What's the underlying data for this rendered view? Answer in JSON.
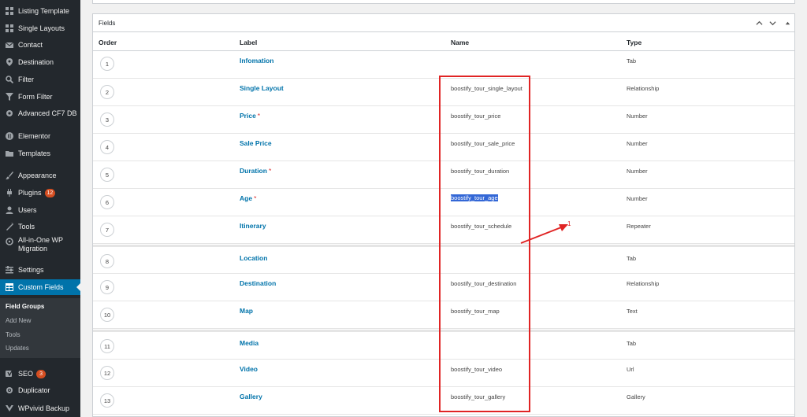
{
  "sidebar": {
    "items": [
      {
        "label": "Listing Template",
        "icon": "grid-icon"
      },
      {
        "label": "Single Layouts",
        "icon": "grid-icon"
      },
      {
        "label": "Contact",
        "icon": "envelope-icon"
      },
      {
        "label": "Destination",
        "icon": "location-pin-icon"
      },
      {
        "label": "Filter",
        "icon": "magnifier-icon"
      },
      {
        "label": "Form Filter",
        "icon": "funnel-icon"
      },
      {
        "label": "Advanced CF7 DB",
        "icon": "gear-icon"
      },
      {
        "label": "Elementor",
        "icon": "elementor-icon"
      },
      {
        "label": "Templates",
        "icon": "folder-icon"
      },
      {
        "label": "Appearance",
        "icon": "brush-icon"
      },
      {
        "label": "Plugins",
        "icon": "plug-icon",
        "badge": "12"
      },
      {
        "label": "Users",
        "icon": "user-icon"
      },
      {
        "label": "Tools",
        "icon": "wrench-icon"
      },
      {
        "label": "All-in-One WP Migration",
        "icon": "migration-icon"
      },
      {
        "label": "Settings",
        "icon": "settings-icon"
      },
      {
        "label": "Custom Fields",
        "icon": "table-icon"
      },
      {
        "label": "SEO",
        "icon": "yoast-icon",
        "badge": "3"
      },
      {
        "label": "Duplicator",
        "icon": "duplicator-icon"
      },
      {
        "label": "WPvivid Backup",
        "icon": "backup-icon"
      }
    ],
    "submenu": [
      "Field Groups",
      "Add New",
      "Tools",
      "Updates"
    ]
  },
  "panel": {
    "title": "Fields"
  },
  "table": {
    "columns": [
      "Order",
      "Label",
      "Name",
      "Type"
    ],
    "rows": [
      {
        "order": "1",
        "label": "Infomation",
        "name": "",
        "type": "Tab"
      },
      {
        "order": "2",
        "label": "Single Layout",
        "name": "boostify_tour_single_layout",
        "type": "Relationship"
      },
      {
        "order": "3",
        "label": "Price",
        "req": "*",
        "name": "boostify_tour_price",
        "type": "Number"
      },
      {
        "order": "4",
        "label": "Sale Price",
        "name": "boostify_tour_sale_price",
        "type": "Number"
      },
      {
        "order": "5",
        "label": "Duration",
        "req": "*",
        "name": "boostify_tour_duration",
        "type": "Number"
      },
      {
        "order": "6",
        "label": "Age",
        "req": "*",
        "name": "boostify_tour_age",
        "type": "Number"
      },
      {
        "order": "7",
        "label": "Itinerary",
        "name": "boostify_tour_schedule",
        "type": "Repeater"
      },
      {
        "order": "8",
        "label": "Location",
        "name": "",
        "type": "Tab"
      },
      {
        "order": "9",
        "label": "Destination",
        "name": "boostify_tour_destination",
        "type": "Relationship"
      },
      {
        "order": "10",
        "label": "Map",
        "name": "boostify_tour_map",
        "type": "Text"
      },
      {
        "order": "11",
        "label": "Media",
        "name": "",
        "type": "Tab"
      },
      {
        "order": "12",
        "label": "Video",
        "name": "boostify_tour_video",
        "type": "Url"
      },
      {
        "order": "13",
        "label": "Gallery",
        "name": "boostify_tour_gallery",
        "type": "Gallery"
      }
    ]
  },
  "annotation": {
    "label": "1",
    "color": "#e02424"
  },
  "colors": {
    "sidebar_bg": "#23282d",
    "active_bg": "#0073aa",
    "link": "#0073aa",
    "badge": "#d54e21",
    "selection": "#3367d6"
  }
}
